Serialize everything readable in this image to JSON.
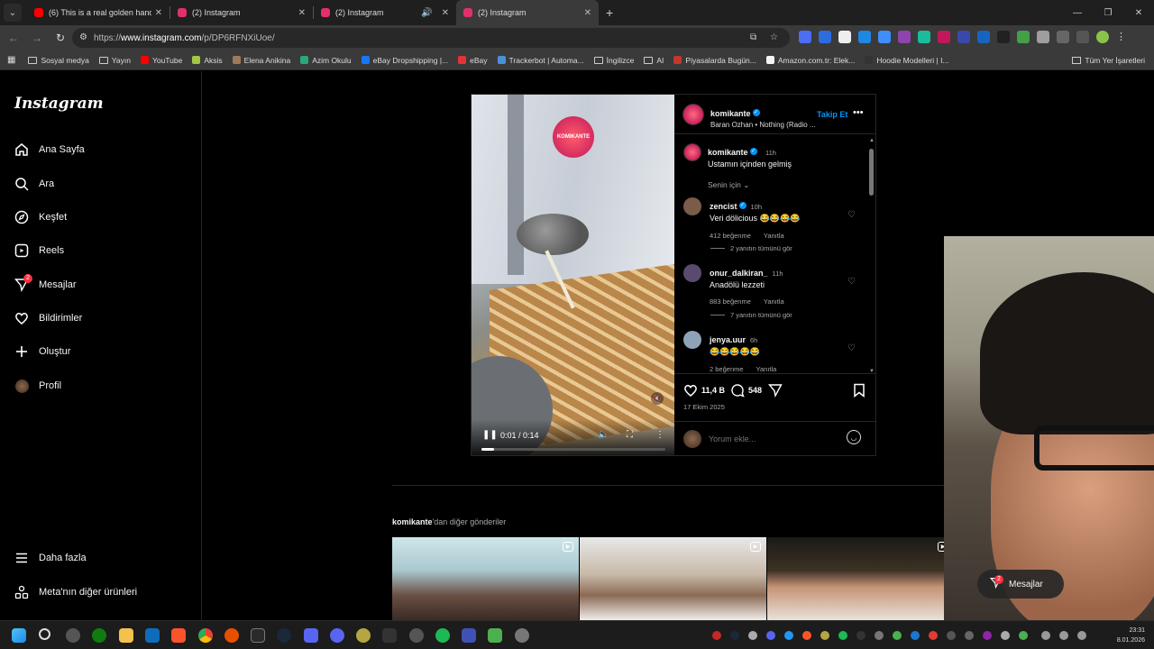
{
  "browser": {
    "tabs": [
      {
        "title": "(6) This is a real golden hand! T",
        "fav_color": "#ff0000",
        "active": false
      },
      {
        "title": "(2) Instagram",
        "fav_color": "#e1306c",
        "active": false
      },
      {
        "title": "(2) Instagram",
        "fav_color": "#e1306c",
        "active": false
      },
      {
        "title": "(2) Instagram",
        "fav_color": "#e1306c",
        "active": true
      }
    ],
    "url_prefix": "https://",
    "url_host": "www.instagram.com",
    "url_path": "/p/DP6RFNXiUoe/",
    "bookmarks": [
      {
        "label": "Sosyal medya",
        "type": "folder"
      },
      {
        "label": "Yayın",
        "type": "folder"
      },
      {
        "label": "YouTube",
        "type": "icon",
        "color": "#ff0000"
      },
      {
        "label": "Aksis",
        "type": "icon",
        "color": "#a3c644"
      },
      {
        "label": "Elena Anikina",
        "type": "icon",
        "color": "#9c7a5b"
      },
      {
        "label": "Azim Okulu",
        "type": "icon",
        "color": "#2aa876"
      },
      {
        "label": "eBay Dropshipping |...",
        "type": "icon",
        "color": "#1877f2"
      },
      {
        "label": "eBay",
        "type": "icon",
        "color": "#e53238"
      },
      {
        "label": "Trackerbot | Automa...",
        "type": "icon",
        "color": "#4a90d9"
      },
      {
        "label": "İngilizce",
        "type": "folder"
      },
      {
        "label": "AI",
        "type": "folder"
      },
      {
        "label": "Piyasalarda Bugün...",
        "type": "icon",
        "color": "#c0392b"
      },
      {
        "label": "Amazon.com.tr: Elek...",
        "type": "icon",
        "color": "#f5f5f5"
      },
      {
        "label": "Hoodie Modelleri | I...",
        "type": "icon",
        "color": "#333333"
      }
    ],
    "all_bookmarks": "Tüm Yer İşaretleri"
  },
  "sidebar": {
    "logo": "Instagram",
    "items": [
      {
        "label": "Ana Sayfa",
        "icon": "home-icon"
      },
      {
        "label": "Ara",
        "icon": "search-icon"
      },
      {
        "label": "Keşfet",
        "icon": "explore-icon"
      },
      {
        "label": "Reels",
        "icon": "reels-icon"
      },
      {
        "label": "Mesajlar",
        "icon": "messages-icon",
        "badge": "2"
      },
      {
        "label": "Bildirimler",
        "icon": "heart-icon"
      },
      {
        "label": "Oluştur",
        "icon": "plus-icon"
      },
      {
        "label": "Profil",
        "icon": "profile-avatar"
      }
    ],
    "more": "Daha fazla",
    "meta": "Meta'nın diğer ürünleri"
  },
  "post": {
    "username": "komikante",
    "audio": "Baran Ozhan • Nothing (Radio ...",
    "follow": "Takip Et",
    "video_logo": "KOMIKANTE",
    "video_time": "0:01 / 0:14",
    "video_progress": 0.07,
    "caption_user": "komikante",
    "caption_time": "11h",
    "caption": "Ustamın içinden gelmiş",
    "for_you": "Senin için",
    "comments": [
      {
        "user": "zencist",
        "verified": true,
        "time": "10h",
        "text": "Veri dölicious 😂😂😂😂",
        "likes": "412 beğenme",
        "reply": "Yanıtla",
        "more_replies": "2 yanıtın tümünü gör",
        "avatar_color": "#7a5c48"
      },
      {
        "user": "onur_dalkiran_",
        "verified": false,
        "time": "11h",
        "text": "Anadölü lezzeti",
        "likes": "883 beğenme",
        "reply": "Yanıtla",
        "more_replies": "7 yanıtın tümünü gör",
        "avatar_color": "#5a4b6e"
      },
      {
        "user": "jenya.uur",
        "verified": false,
        "time": "6h",
        "text": "😂😂😂😂😂",
        "likes": "2 beğenme",
        "reply": "Yanıtla",
        "more_replies": "",
        "avatar_color": "#8fa3b8"
      }
    ],
    "like_count": "11,4 B",
    "comment_count": "548",
    "date": "17 Ekim 2025",
    "comment_placeholder": "Yorum ekle..."
  },
  "more_posts": {
    "user": "komikante",
    "suffix": "'dan diğer gönderiler"
  },
  "messages_pill": {
    "label": "Mesajlar",
    "badge": "2"
  },
  "taskbar": {
    "time": "23:31",
    "date": "8.01.2026"
  }
}
